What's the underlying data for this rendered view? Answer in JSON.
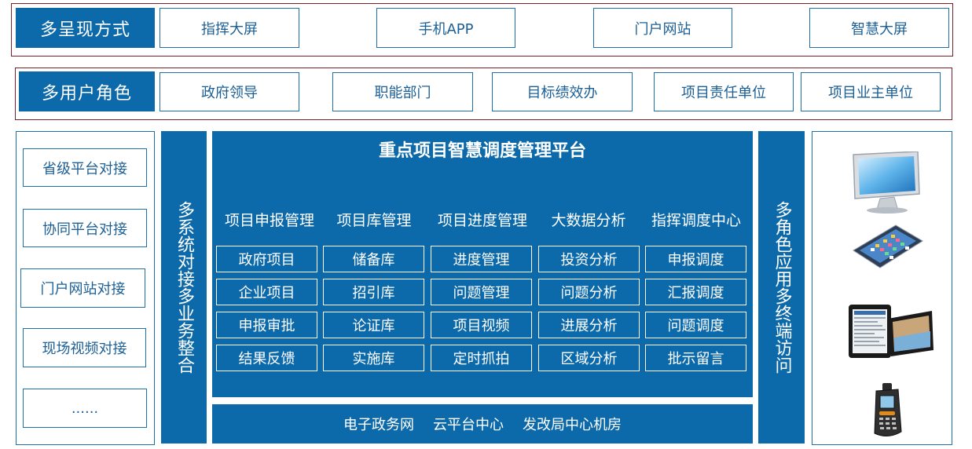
{
  "presentation": {
    "title": "多呈现方式",
    "items": [
      "指挥大屏",
      "手机APP",
      "门户网站",
      "智慧大屏"
    ]
  },
  "roles": {
    "title": "多用户角色",
    "items": [
      "政府领导",
      "职能部门",
      "目标绩效办",
      "项目责任单位",
      "项目业主单位"
    ]
  },
  "left_panel": {
    "items": [
      "省级平台对接",
      "协同平台对接",
      "门户网站对接",
      "现场视频对接",
      "......"
    ]
  },
  "left_bar": {
    "text": "多系统对接多业务整合"
  },
  "right_bar": {
    "text": "多角色应用多终端访问"
  },
  "platform": {
    "title": "重点项目智慧调度管理平台",
    "columns": [
      {
        "header": "项目申报管理",
        "cells": [
          "政府项目",
          "企业项目",
          "申报审批",
          "结果反馈"
        ]
      },
      {
        "header": "项目库管理",
        "cells": [
          "储备库",
          "招引库",
          "论证库",
          "实施库"
        ]
      },
      {
        "header": "项目进度管理",
        "cells": [
          "进度管理",
          "问题管理",
          "项目视频",
          "定时抓拍"
        ]
      },
      {
        "header": "大数据分析",
        "cells": [
          "投资分析",
          "问题分析",
          "进展分析",
          "区域分析"
        ]
      },
      {
        "header": "指挥调度中心",
        "cells": [
          "申报调度",
          "汇报调度",
          "问题调度",
          "批示留言"
        ]
      }
    ]
  },
  "infrastructure": {
    "items": [
      "电子政务网",
      "云平台中心",
      "发改局中心机房"
    ]
  },
  "devices": [
    "monitor-icon",
    "smartphone-icon",
    "tablet-icon",
    "handheld-terminal-icon"
  ]
}
